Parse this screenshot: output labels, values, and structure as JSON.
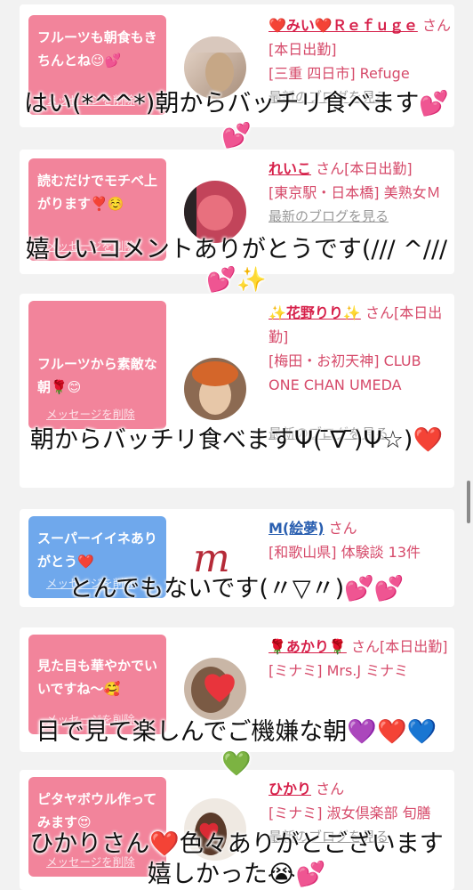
{
  "comments": [
    {
      "message": "フルーツも朝食もきちんとね😉💕",
      "delete_label": "メッセージを削除",
      "name": "❤️みい❤️Ｒｅｆｕｇｅ",
      "suffix": "さん[本日出勤]",
      "area": "[三重 四日市] Refuge",
      "blog": "最新のブログを見る",
      "reply": "はい(*^^*)朝からバッチリ食べます💕",
      "reply2": "💕"
    },
    {
      "message": "読むだけでモチベ上がります❣️☺️",
      "delete_label": "メッセージを削除",
      "name": "れいこ",
      "suffix": "さん[本日出勤]",
      "area": "[東京駅・日本橋] 美熟女Ｍ",
      "blog": "最新のブログを見る",
      "reply": "嬉しいコメントありがとうです(/// ^///",
      "reply2": "💕✨"
    },
    {
      "message": "フルーツから素敵な朝🌹😊",
      "delete_label": "メッセージを削除",
      "name": "✨花野りり✨",
      "suffix": "さん[本日出勤]",
      "area": "[梅田・お初天神] CLUB ONE CHAN UMEDA",
      "blog": "最新のブログを見る",
      "reply": "朝からバッチリ食べますΨ( ̄∇ ̄)Ψ☆)❤️"
    },
    {
      "message": "スーパーイイネありがとう❤️",
      "delete_label": "メッセージを削除",
      "name": "M(絵夢)",
      "suffix": "さん",
      "area": "[和歌山県] 体験談 13件",
      "reply": "とんでもないです(〃▽〃)💕💕"
    },
    {
      "message": "見た目も華やかでいいですね〜🥰",
      "delete_label": "メッセージを削除",
      "name": "🌹あかり🌹",
      "suffix": "さん[本日出勤]",
      "area": "[ミナミ] Mrs.J ミナミ",
      "reply": "目で見て楽しんでご機嫌な朝💜❤️💙",
      "reply2": "💚"
    },
    {
      "message": "ピタヤボウル作ってみます😍",
      "delete_label": "メッセージを削除",
      "name": "ひかり",
      "suffix": "さん",
      "area": "[ミナミ] 淑女倶楽部 旬膳",
      "blog": "最新のブログを見る",
      "reply": "ひかりさん❤️色々ありがとございます",
      "reply2": "嬉しかった😭💕"
    }
  ],
  "colors": {
    "bubble_pink": "#f2849b",
    "bubble_blue": "#6fa8ec",
    "name_red": "#d6204a",
    "name_blue": "#2a5fb0"
  }
}
